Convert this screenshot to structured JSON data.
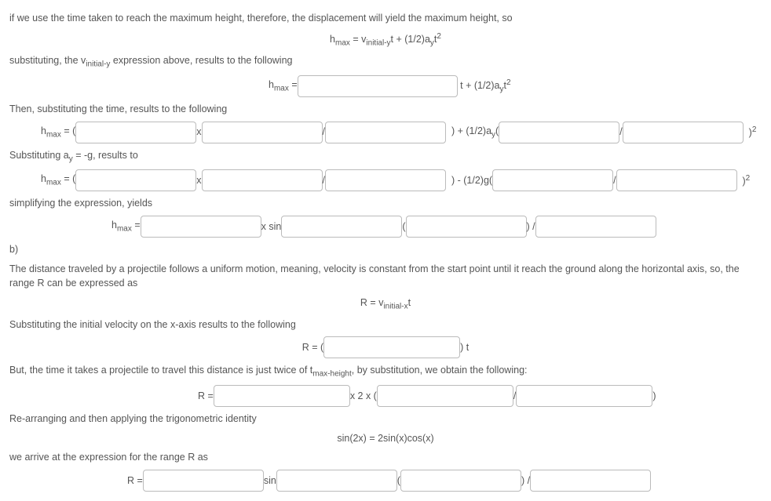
{
  "line1": "if we use the time taken to reach the maximum height, therefore, the displacement will yield the maximum height, so",
  "eq1_pre": "h",
  "eq1_sub": "max",
  "eq1_mid": " = v",
  "eq1_sub2": "initial-y",
  "eq1_after": "t + (1/2)a",
  "eq1_sub3": "y",
  "eq1_after2": "t",
  "eq1_sup": "2",
  "line2": "substituting, the v",
  "line2_sub": "initial-y",
  "line2_after": " expression above, results to the following",
  "eq2_h": "h",
  "eq2_hmax": "max",
  "eq2_eq": " = ",
  "eq2_mid": "t + (1/2)a",
  "eq2_sub": "y",
  "eq2_after": "t",
  "eq2_sup": "2",
  "line3": "Then, substituting the time, results to the following",
  "eq3_h": "h",
  "eq3_hmax": "max",
  "eq3_eq": " = ( ",
  "eq3_x": " x ",
  "eq3_slash": " / ",
  "eq3_mid": " ) + (1/2)a",
  "eq3_sub": "y",
  "eq3_open": "( ",
  "eq3_slash2": " / ",
  "eq3_close": " )",
  "eq3_sup": "2",
  "line4_pre": "Substituting a",
  "line4_sub": "y",
  "line4_after": " = -g, results to",
  "eq4_h": "h",
  "eq4_hmax": "max",
  "eq4_eq": " = ( ",
  "eq4_x": " x ",
  "eq4_slash": " / ",
  "eq4_mid": " ) - (1/2)g( ",
  "eq4_slash2": " / ",
  "eq4_close": " )",
  "eq4_sup": "2",
  "line5": "simplifying the expression, yields",
  "eq5_h": "h",
  "eq5_hmax": "max",
  "eq5_eq": " = ",
  "eq5_xsin": " x sin ",
  "eq5_open": " ( ",
  "eq5_close": " ) / ",
  "partb": "b)",
  "line6": "The distance traveled by a projectile follows a uniform motion, meaning, velocity is constant from the start point until it reach the ground along the horizontal axis, so, the range R can be expressed as",
  "eq6_pre": "R = v",
  "eq6_sub": "initial-x",
  "eq6_after": "t",
  "line7": "Substituting the initial velocity on the x-axis results to the following",
  "eq7_pre": "R = ( ",
  "eq7_close": " ) t",
  "line8_pre": "But, the time it takes a projectile to travel this distance is just twice of t",
  "line8_sub": "max-height",
  "line8_after": ", by substitution, we obtain the following:",
  "eq8_pre": "R = ",
  "eq8_mid": " x 2 x ( ",
  "eq8_slash": " / ",
  "eq8_close": " )",
  "line9": "Re-arranging and then applying the trigonometric identity",
  "eq9": "sin(2x) = 2sin(x)cos(x)",
  "line10": "we arrive at the expression for the range R as",
  "eq10_pre": "R = ",
  "eq10_sin": " sin ",
  "eq10_open": " ( ",
  "eq10_close": " ) / "
}
